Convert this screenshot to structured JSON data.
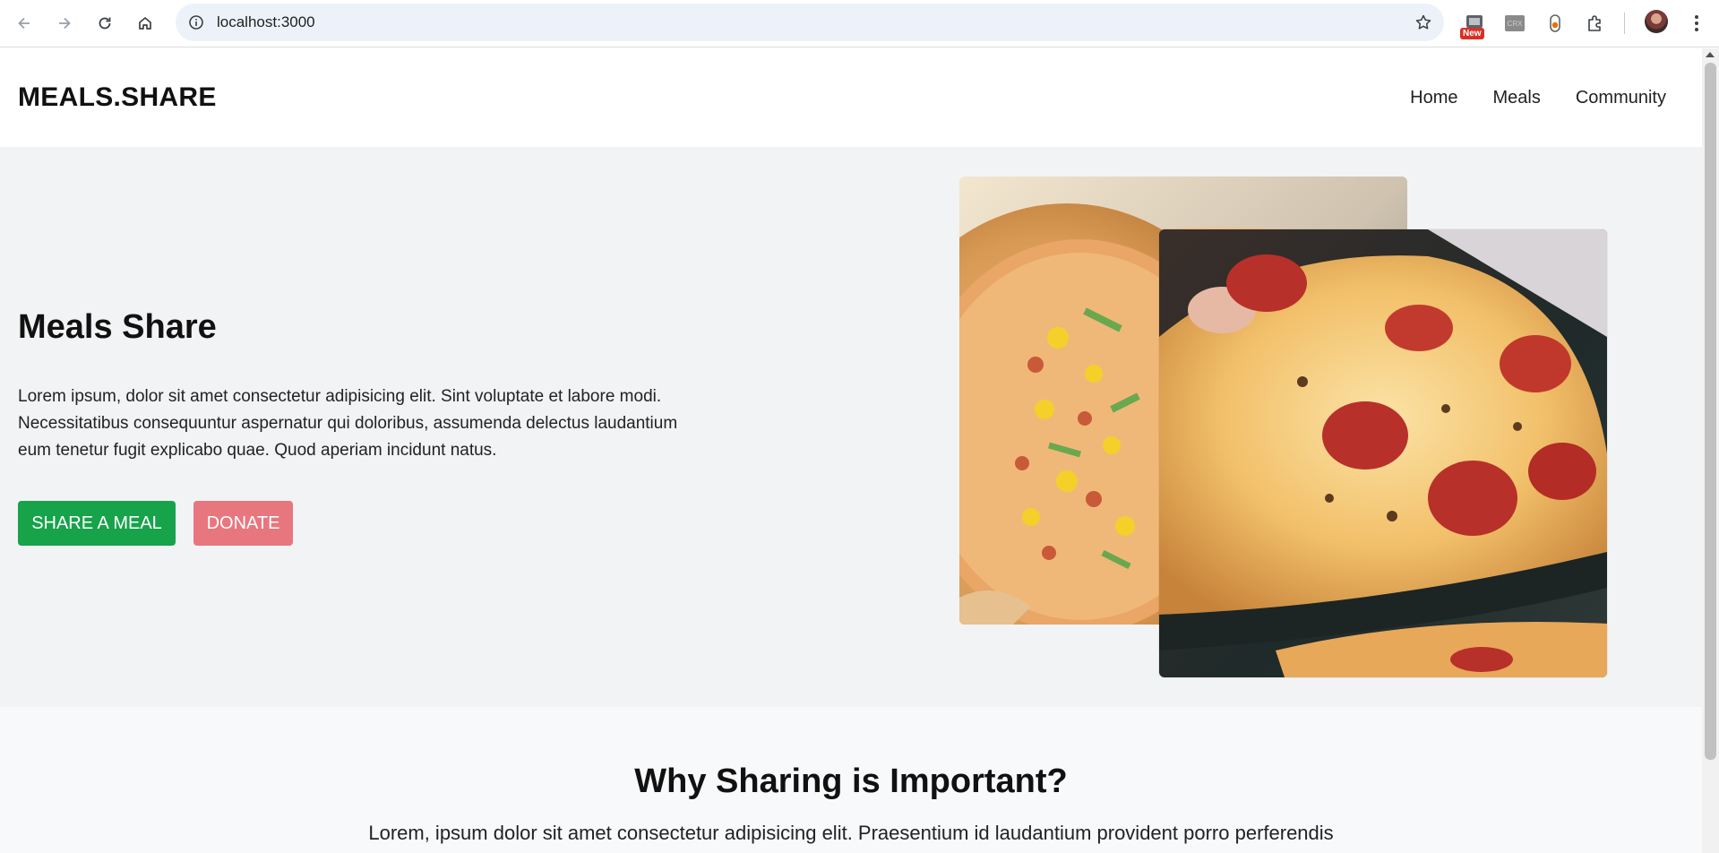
{
  "browser": {
    "url": "localhost:3000",
    "new_badge": "New",
    "crx_label": "CRX",
    "icons": [
      "back-icon",
      "forward-icon",
      "reload-icon",
      "home-icon",
      "info-icon",
      "star-icon",
      "extensions-icon",
      "kebab-menu-icon"
    ]
  },
  "header": {
    "brand": "MEALS.SHARE",
    "nav": [
      "Home",
      "Meals",
      "Community"
    ]
  },
  "hero": {
    "title": "Meals Share",
    "text": "Lorem ipsum, dolor sit amet consectetur adipisicing elit. Sint voluptate et labore modi. Necessitatibus consequuntur aspernatur qui doloribus, assumenda delectus laudantium eum tenetur fugit explicabo quae. Quod aperiam incidunt natus.",
    "share_label": "SHARE A MEAL",
    "donate_label": "DONATE"
  },
  "why": {
    "title": "Why Sharing is Important?",
    "text": "Lorem, ipsum dolor sit amet consectetur adipisicing elit. Praesentium id laudantium provident porro perferendis"
  },
  "colors": {
    "primary_green": "#16a34a",
    "donate_pink": "#e8767e",
    "hero_bg": "#f2f3f5"
  }
}
